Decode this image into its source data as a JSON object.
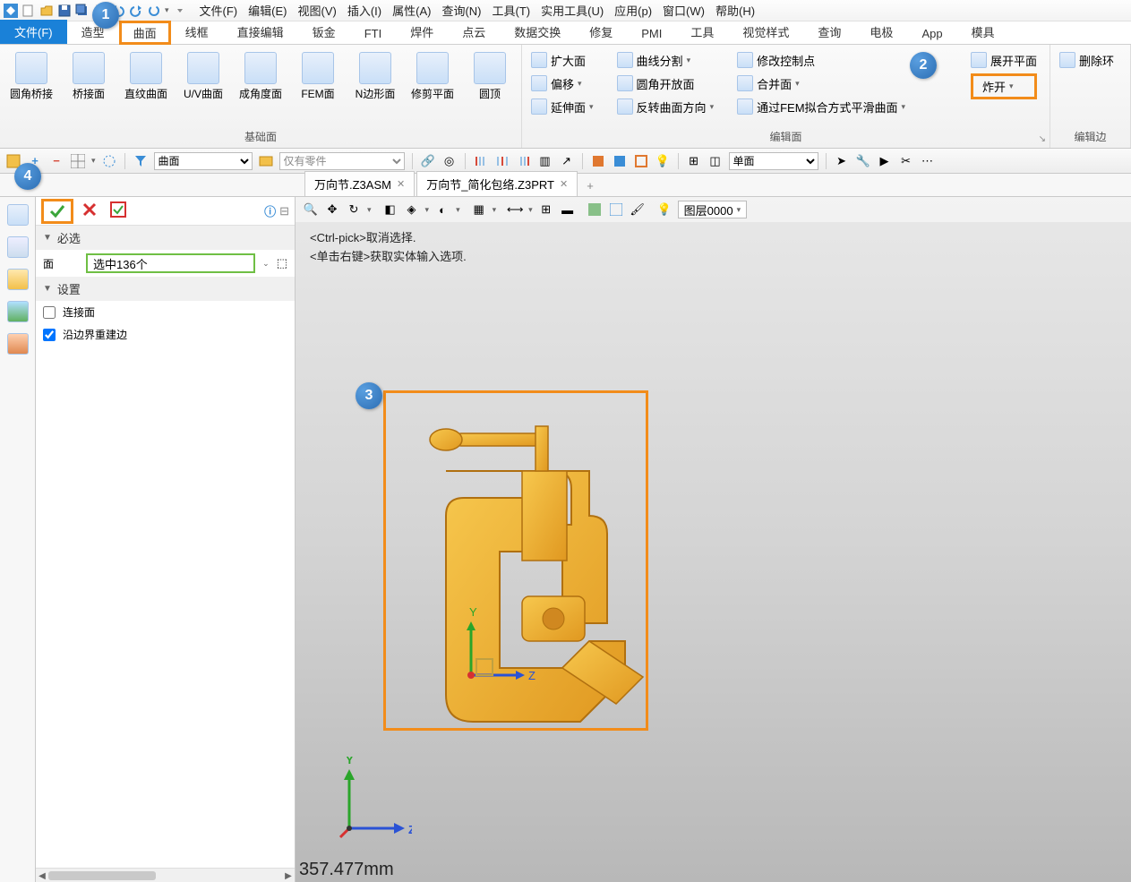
{
  "menubar": {
    "items": [
      "文件(F)",
      "编辑(E)",
      "视图(V)",
      "插入(I)",
      "属性(A)",
      "查询(N)",
      "工具(T)",
      "实用工具(U)",
      "应用(p)",
      "窗口(W)",
      "帮助(H)"
    ]
  },
  "ribbon_tabs": [
    "文件(F)",
    "造型",
    "曲面",
    "线框",
    "直接编辑",
    "钣金",
    "FTI",
    "焊件",
    "点云",
    "数据交换",
    "修复",
    "PMI",
    "工具",
    "视觉样式",
    "查询",
    "电极",
    "App",
    "模具"
  ],
  "ribbon": {
    "group1_label": "基础面",
    "big_buttons": [
      "圆角桥接",
      "桥接面",
      "直纹曲面",
      "U/V曲面",
      "成角度面",
      "FEM面",
      "N边形面",
      "修剪平面",
      "圆顶"
    ],
    "group2_label": "编辑面",
    "edit_col1": [
      "扩大面",
      "偏移",
      "延伸面"
    ],
    "edit_col2": [
      "曲线分割",
      "圆角开放面",
      "反转曲面方向"
    ],
    "edit_col3": [
      "修改控制点",
      "合并面",
      "通过FEM拟合方式平滑曲面"
    ],
    "explode": "炸开",
    "unfold": "展开平面",
    "delete_loop": "删除环",
    "group3_label": "编辑边"
  },
  "toolbar2": {
    "sel_filter": "曲面",
    "part_filter": "仅有零件",
    "face_mode": "单面"
  },
  "doc_tabs": [
    {
      "label": "万向节.Z3ASM"
    },
    {
      "label": "万向节_简化包络.Z3PRT"
    }
  ],
  "panel": {
    "required": "必选",
    "face_label": "面",
    "face_value": "选中136个",
    "settings": "设置",
    "opt_connect": "连接面",
    "opt_rebuild": "沿边界重建边"
  },
  "viewport": {
    "hint1": "<Ctrl-pick>取消选择.",
    "hint2": "<单击右键>获取实体输入选项.",
    "layer": "图层0000",
    "axis_y": "Y",
    "axis_z": "Z",
    "axis_y2": "Y",
    "axis_z2": "Z"
  },
  "status_value": "357.477mm",
  "badges": {
    "b1": "1",
    "b2": "2",
    "b3": "3",
    "b4": "4"
  }
}
